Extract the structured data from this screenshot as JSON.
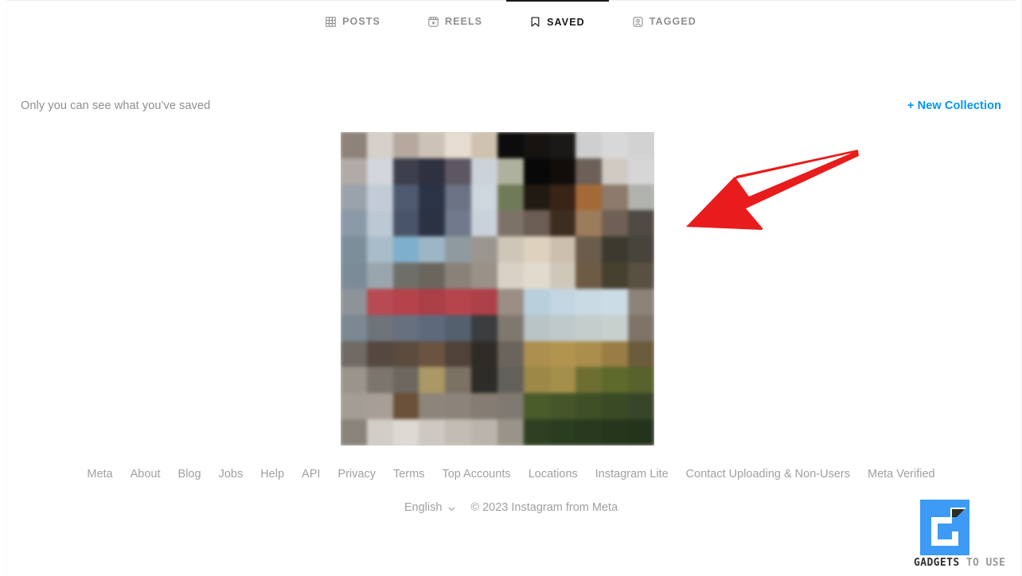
{
  "tabs": [
    {
      "id": "posts",
      "label": "POSTS",
      "icon": "grid-icon",
      "active": false
    },
    {
      "id": "reels",
      "label": "REELS",
      "icon": "reels-icon",
      "active": false
    },
    {
      "id": "saved",
      "label": "SAVED",
      "icon": "bookmark-icon",
      "active": true
    },
    {
      "id": "tagged",
      "label": "TAGGED",
      "icon": "tagged-icon",
      "active": false
    }
  ],
  "notice": {
    "text": "Only you can see what you've saved",
    "new_collection_label": "+ New Collection",
    "accent_color": "#0095f6"
  },
  "saved": {
    "thumbnail_alt": "saved-post-thumbnail",
    "censored": "pixelated"
  },
  "annotation": {
    "type": "arrow",
    "color": "#e81c1c",
    "points_to": "new-collection-link"
  },
  "footer": {
    "links": [
      "Meta",
      "About",
      "Blog",
      "Jobs",
      "Help",
      "API",
      "Privacy",
      "Terms",
      "Top Accounts",
      "Locations",
      "Instagram Lite",
      "Contact Uploading & Non-Users",
      "Meta Verified"
    ],
    "language": "English",
    "language_chevron": "chevron-down-icon",
    "copyright": "© 2023 Instagram from Meta"
  },
  "watermark": {
    "brand_primary": "GADGETS",
    "brand_secondary": " TO USE",
    "logo_color": "#3d9bf5"
  },
  "mosaic": {
    "colors": [
      "#8e8279",
      "#d5d0ca",
      "#b5a99f",
      "#cdc2b6",
      "#e6ddd0",
      "#cfc2ae",
      "#0c0c0c",
      "#161311",
      "#1b1917",
      "#cfcfcf",
      "#d8d8d8",
      "#d2d2d2",
      "#b0aba6",
      "#d2d6dc",
      "#3e3f4d",
      "#2e3140",
      "#5d5763",
      "#ccd2da",
      "#aeb19c",
      "#080808",
      "#100d0b",
      "#6d6058",
      "#cfcac2",
      "#d6d6d6",
      "#9aa3ab",
      "#c3ccd6",
      "#4e5a70",
      "#2b3447",
      "#6a7284",
      "#ced6de",
      "#6e7a58",
      "#211a12",
      "#3a2317",
      "#a36a38",
      "#8d7a6c",
      "#b0b2ad",
      "#8a99a6",
      "#bcc9d4",
      "#4a5468",
      "#2a3244",
      "#707a8c",
      "#c9d2da",
      "#7d7268",
      "#6b5d53",
      "#3d2c20",
      "#9d7c5c",
      "#6e6054",
      "#4f4a44",
      "#7d8e9b",
      "#a8bcc9",
      "#7fb0cb",
      "#9db6c6",
      "#8f9aa0",
      "#9a958e",
      "#cfc6b8",
      "#ded2bf",
      "#cdbfae",
      "#6b5c4b",
      "#3c3a2e",
      "#46443b",
      "#7b8b97",
      "#9aa6ad",
      "#6f6f6a",
      "#6a665e",
      "#8a8279",
      "#9a9289",
      "#d9d2c4",
      "#e2dbcd",
      "#cfc8ba",
      "#6d5b46",
      "#46402f",
      "#585040",
      "#8e939a",
      "#b74a52",
      "#b4434c",
      "#aa3f48",
      "#b5444d",
      "#ae4049",
      "#9a8e86",
      "#b9cfdc",
      "#c3d6e1",
      "#c9dae4",
      "#ccdce6",
      "#8c8378",
      "#7b8791",
      "#6e737a",
      "#67707f",
      "#5d6a7e",
      "#55606f",
      "#3a3c3e",
      "#7f786f",
      "#b9c4c6",
      "#bfc9ca",
      "#c4cdcc",
      "#c8d0ce",
      "#7e7468",
      "#6f6a64",
      "#54483f",
      "#5a4b3e",
      "#6b5340",
      "#4f4238",
      "#2f2b26",
      "#6a645c",
      "#ad8f4e",
      "#b2944f",
      "#ab8d4c",
      "#9a7d44",
      "#6b5c3c",
      "#9b948c",
      "#7c756d",
      "#6d675f",
      "#ab9864",
      "#7b7264",
      "#2e2c28",
      "#63605a",
      "#9d8848",
      "#a48e4a",
      "#6e6e33",
      "#5d6a2c",
      "#58622c",
      "#a49d95",
      "#a79f97",
      "#6b5139",
      "#8d857b",
      "#8c847a",
      "#857d73",
      "#7f7a71",
      "#4a5c2a",
      "#46562a",
      "#3f5027",
      "#3a4a24",
      "#37462a",
      "#8a837b",
      "#d2cdc6",
      "#dedad3",
      "#cdc8c1",
      "#c2bcb4",
      "#bab4ac",
      "#999389",
      "#2e4020",
      "#2b3d1f",
      "#28391e",
      "#26361c",
      "#24331b"
    ]
  }
}
